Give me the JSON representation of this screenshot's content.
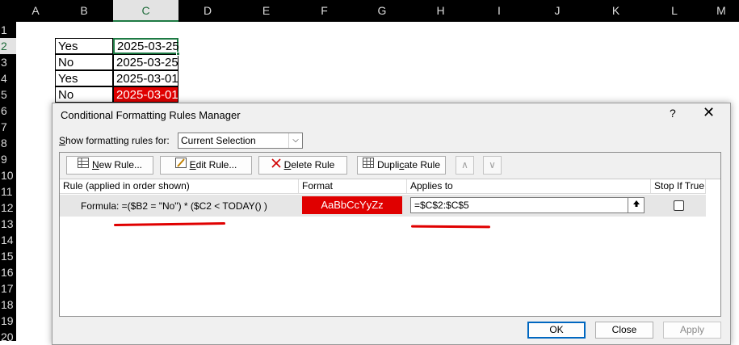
{
  "spreadsheet": {
    "columns": [
      "A",
      "B",
      "C",
      "D",
      "E",
      "F",
      "G",
      "H",
      "I",
      "J",
      "K",
      "L",
      "M"
    ],
    "rows": [
      "1",
      "2",
      "3",
      "4",
      "5",
      "6",
      "7",
      "8",
      "9",
      "10",
      "11",
      "12",
      "13",
      "14",
      "15",
      "16",
      "17",
      "18",
      "19",
      "20"
    ],
    "cells": [
      {
        "b": "Yes",
        "c": "2025-03-25"
      },
      {
        "b": "No",
        "c": "2025-03-25"
      },
      {
        "b": "Yes",
        "c": "2025-03-01"
      },
      {
        "b": "No",
        "c": "2025-03-01"
      }
    ],
    "highlight_color": "#e00000",
    "selection_color": "#1e7a44"
  },
  "dialog": {
    "title": "Conditional Formatting Rules Manager",
    "help": "?",
    "close": "✕",
    "show_rules_for_label": "Show formatting rules for:",
    "show_rules_for_value": "Current Selection",
    "toolbar": {
      "new_rule": "New Rule...",
      "edit_rule": "Edit Rule...",
      "delete_rule": "Delete Rule",
      "duplicate_rule": "Duplicate Rule",
      "move_up": "∧",
      "move_down": "∨"
    },
    "list_headers": {
      "rule": "Rule (applied in order shown)",
      "format": "Format",
      "applies_to": "Applies to",
      "stop_if_true": "Stop If True"
    },
    "rule": {
      "formula": "Formula: =($B2 = \"No\") * ($C2 < TODAY() )",
      "format_preview": "AaBbCcYyZz",
      "applies_to": "=$C$2:$C$5",
      "stop_if_true": false
    },
    "buttons": {
      "ok": "OK",
      "close": "Close",
      "apply": "Apply"
    }
  }
}
